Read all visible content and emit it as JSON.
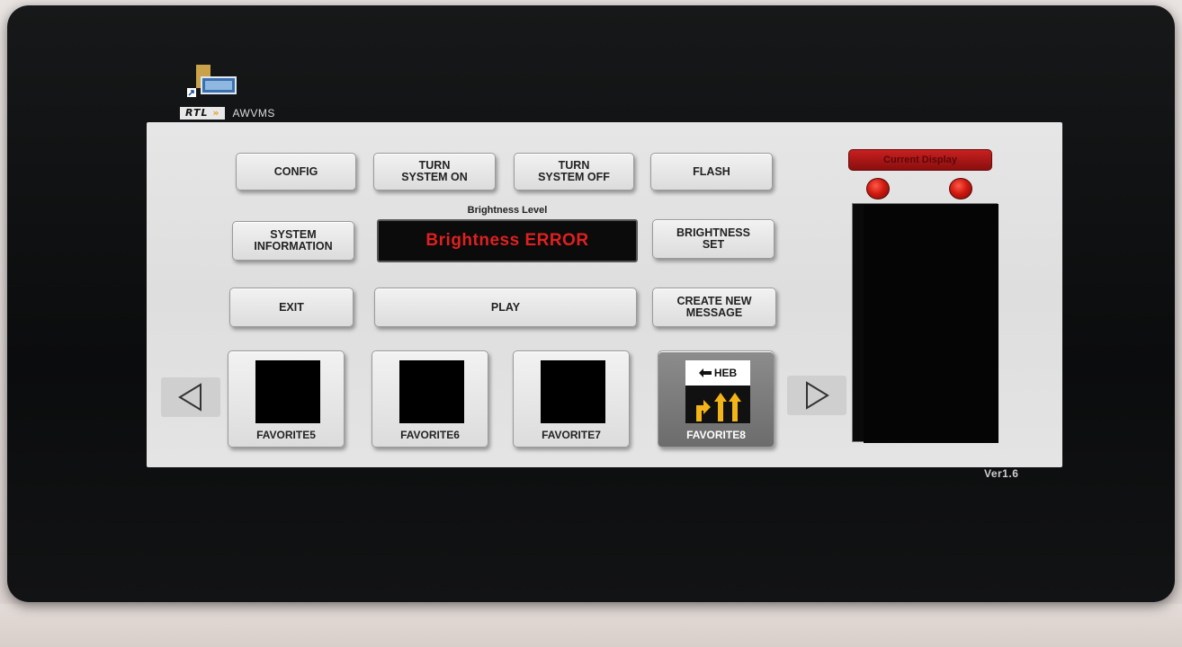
{
  "app": {
    "brand_logo": "RTL",
    "brand_arrows": "»",
    "title": "AWVMS",
    "version": "Ver1.6"
  },
  "toolbar": {
    "config": "CONFIG",
    "turn_on": "TURN\nSYSTEM ON",
    "turn_off": "TURN\nSYSTEM OFF",
    "flash": "FLASH",
    "system_info": "SYSTEM\nINFORMATION",
    "brightness_set": "BRIGHTNESS\nSET",
    "exit": "EXIT",
    "play": "PLAY",
    "create_message": "CREATE NEW\nMESSAGE"
  },
  "brightness": {
    "title": "Brightness Level",
    "status": "Brightness ERROR",
    "status_color": "#e02020"
  },
  "favorites": [
    {
      "label": "FAVORITE5",
      "selected": false
    },
    {
      "label": "FAVORITE6",
      "selected": false
    },
    {
      "label": "FAVORITE7",
      "selected": false
    },
    {
      "label": "FAVORITE8",
      "selected": true,
      "thumb_text": "HEB"
    }
  ],
  "navigation": {
    "prev_icon": "triangle-left-icon",
    "next_icon": "triangle-right-icon"
  },
  "display_panel": {
    "button_label": "Current Display",
    "led_color": "#d01a10"
  }
}
